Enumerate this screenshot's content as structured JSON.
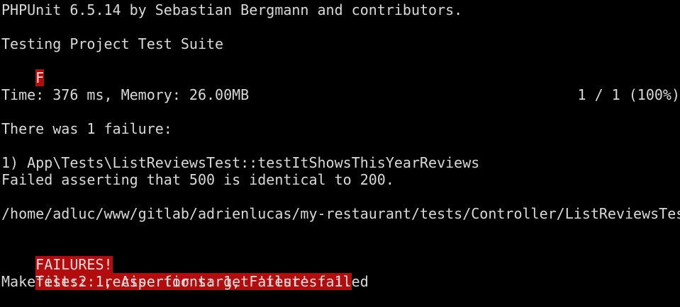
{
  "terminal": {
    "lines": {
      "header": "PHPUnit 6.5.14 by Sebastian Bergmann and contributors.",
      "suite": "Testing Project Test Suite",
      "progress_marker": "F",
      "progress_count": "1 / 1 (100%)",
      "time": "Time: 376 ms, Memory: 26.00MB",
      "failure_intro": "There was 1 failure:",
      "failure_test": "1) App\\Tests\\ListReviewsTest::testItShowsThisYearReviews",
      "failure_message": "Failed asserting that 500 is identical to 200.",
      "failure_path": "/home/adluc/www/gitlab/adrienlucas/my-restaurant/tests/Controller/ListReviewsTes",
      "failures_banner": "FAILURES!",
      "summary": "Tests: 1, Assertions: 1, Failures: 1.",
      "make_error": "Makefile:2: recipe for target 'test' failed"
    },
    "colors": {
      "background": "#000000",
      "text": "#d9d9d9",
      "failure_highlight": "#b30c0c"
    }
  }
}
